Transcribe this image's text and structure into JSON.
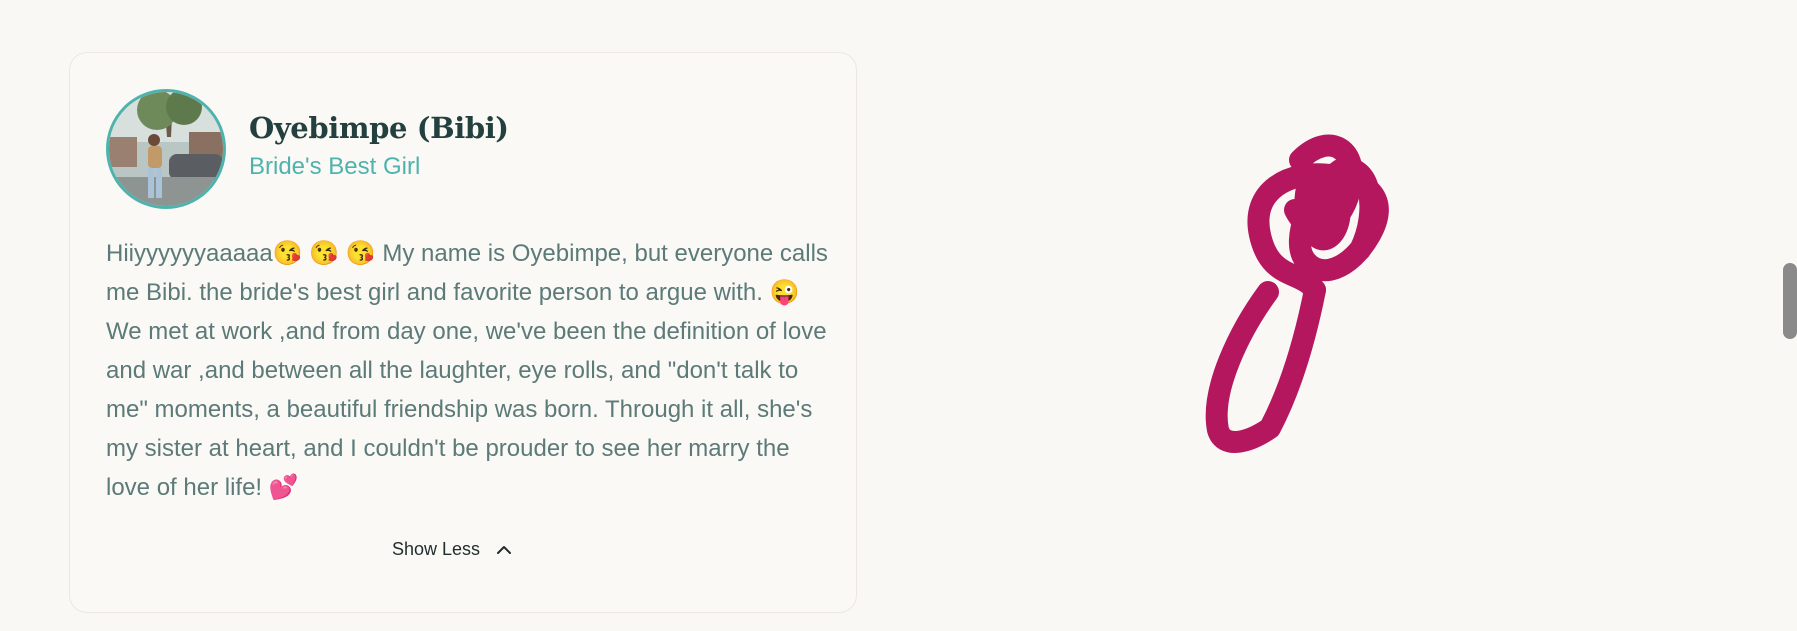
{
  "profile": {
    "name": "Oyebimpe (Bibi)",
    "role": "Bride's Best Girl",
    "bio": "Hiiyyyyyyaaaaa😘 😘 😘 My name is Oyebimpe, but everyone calls me Bibi. the bride's best girl and favorite person to argue with. 😜 We met at work ,and from day one, we've been the definition of love and war ,and between all the laughter, eye rolls, and \"don't talk to me\" moments, a beautiful friendship was born. Through it all, she's my sister at heart, and I couldn't be prouder to see her marry the love of her life! 💕",
    "toggle_label": "Show Less",
    "toggle_icon": "chevron-up-icon",
    "avatar_icon": "profile-photo"
  },
  "decoration": {
    "icon": "scribble-doodle",
    "color": "#b5175f"
  },
  "colors": {
    "accent": "#4fb3ad",
    "heading": "#23403f",
    "body": "#5c7a78",
    "background": "#faf8f5"
  }
}
